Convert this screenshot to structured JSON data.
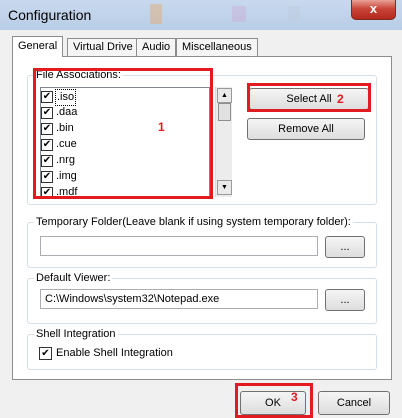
{
  "window": {
    "title": "Configuration",
    "close_glyph": "x"
  },
  "tabs": [
    {
      "label": "General"
    },
    {
      "label": "Virtual Drive"
    },
    {
      "label": "Audio"
    },
    {
      "label": "Miscellaneous"
    }
  ],
  "file_associations": {
    "label": "File Associations:",
    "items": [
      {
        "ext": ".iso",
        "checked": true
      },
      {
        "ext": ".daa",
        "checked": true
      },
      {
        "ext": ".bin",
        "checked": true
      },
      {
        "ext": ".cue",
        "checked": true
      },
      {
        "ext": ".nrg",
        "checked": true
      },
      {
        "ext": ".img",
        "checked": true
      },
      {
        "ext": ".mdf",
        "checked": true
      }
    ],
    "select_all_label": "Select All",
    "remove_all_label": "Remove All",
    "scroll_up_glyph": "▲",
    "scroll_down_glyph": "▼"
  },
  "temp_folder": {
    "label": "Temporary Folder(Leave blank if using system temporary folder):",
    "value": "",
    "browse_label": "..."
  },
  "default_viewer": {
    "label": "Default Viewer:",
    "value": "C:\\Windows\\system32\\Notepad.exe",
    "browse_label": "..."
  },
  "shell": {
    "label": "Shell Integration",
    "checkbox_label": "Enable Shell Integration",
    "checked": true
  },
  "footer": {
    "ok_label": "OK",
    "cancel_label": "Cancel"
  },
  "annotations": {
    "n1": "1",
    "n2": "2",
    "n3": "3",
    "color": "#e21b23"
  },
  "check_glyph": "✔"
}
